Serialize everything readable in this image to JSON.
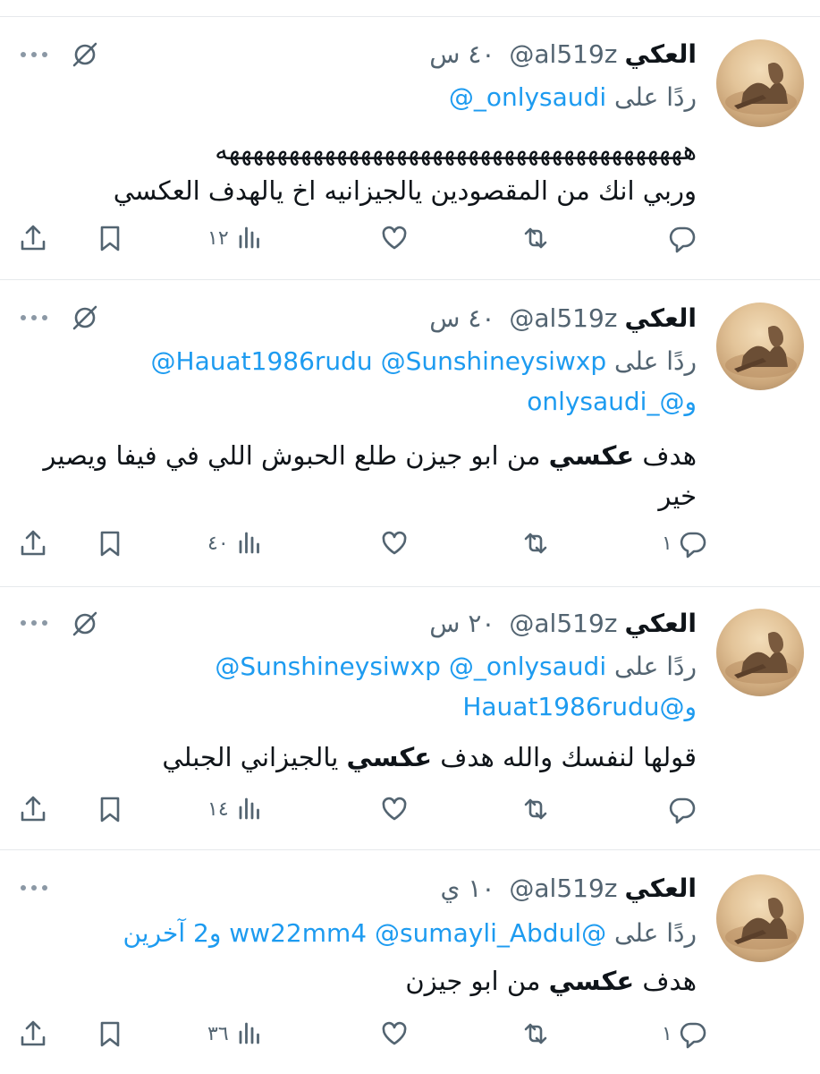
{
  "tweets": [
    {
      "name": "العكي",
      "handle": "@al519z",
      "time": "٤٠ س",
      "reply_prefix": "ردًا على",
      "mentions_line1": "@_onlysaudi",
      "mentions_line2": "",
      "text_lines": [
        "هههههههههههههههههههههههههههههههههههههههه",
        "وربي انك من المقصودين يالجيزانيه اخ يالهدف العكسي"
      ],
      "replies": "",
      "views": "١٢",
      "muted": true
    },
    {
      "name": "العكي",
      "handle": "@al519z",
      "time": "٤٠ س",
      "reply_prefix": "ردًا على",
      "mentions_line1": "@Hauat1986rudu @Sunshineysiwxp",
      "mentions_line2": "و@_onlysaudi",
      "text_pre": "هدف ",
      "text_bold": "عكسي",
      "text_post": " من ابو جيزن طلع الحبوش اللي في فيفا ويصير",
      "text_line2": "خير",
      "replies": "١",
      "views": "٤٠",
      "muted": true
    },
    {
      "name": "العكي",
      "handle": "@al519z",
      "time": "٢٠ س",
      "reply_prefix": "ردًا على",
      "mentions_line1": "@Sunshineysiwxp @_onlysaudi",
      "mentions_line2": "و@Hauat1986rudu",
      "text_pre": "قولها لنفسك والله هدف ",
      "text_bold": "عكسي",
      "text_post": " يالجيزاني الجبلي",
      "replies": "",
      "views": "١٤",
      "muted": true
    },
    {
      "name": "العكي",
      "handle": "@al519z",
      "time": "١٠ ي",
      "reply_prefix": "ردًا على",
      "mentions_line1": "@ww22mm4 @sumayli_Abdul و2 آخرين",
      "text_pre": "هدف ",
      "text_bold": "عكسي",
      "text_post": " من ابو جيزن",
      "replies": "١",
      "views": "٣٦",
      "muted": false
    }
  ],
  "icons": {
    "reply": "reply-icon",
    "retweet": "retweet-icon",
    "like": "heart-icon",
    "views": "views-icon",
    "bookmark": "bookmark-icon",
    "share": "share-icon",
    "more": "more-icon",
    "muted": "muted-icon"
  },
  "colors": {
    "link": "#1d9bf0",
    "secondary": "#536471",
    "text": "#0f1419"
  }
}
